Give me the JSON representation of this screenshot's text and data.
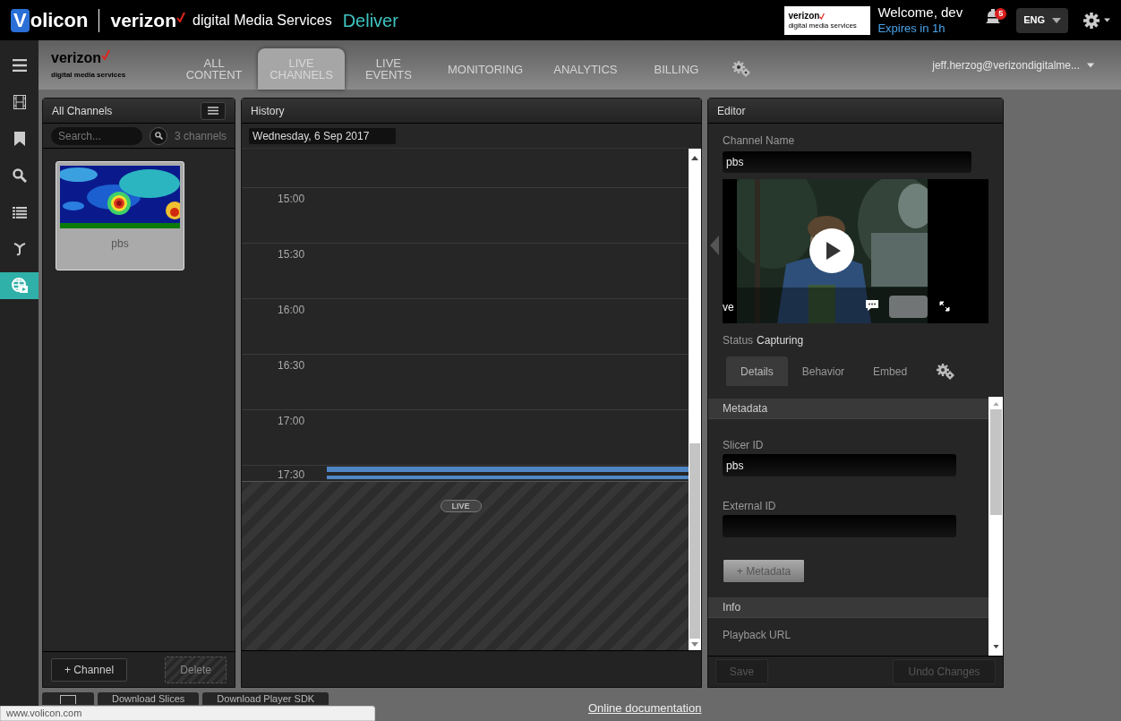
{
  "header": {
    "brand_mark": "V",
    "brand": "olicon",
    "partner": "verizon",
    "partner_sub": "digital Media Services",
    "product": "Deliver",
    "badge_logo": "verizon",
    "badge_sub": "digital media services",
    "welcome": "Welcome, dev",
    "expires": "Expires in 1h",
    "notifications": "5",
    "language": "ENG"
  },
  "sidebar": {
    "items": [
      {
        "kind": "film",
        "selected": false
      },
      {
        "kind": "bookmark",
        "selected": false
      },
      {
        "kind": "search",
        "selected": false
      },
      {
        "kind": "list",
        "selected": false
      },
      {
        "kind": "fork",
        "selected": false
      },
      {
        "kind": "globe",
        "selected": true
      }
    ]
  },
  "nav": {
    "logo": "verizon",
    "logo_sub": "digital media services",
    "tabs": [
      {
        "lines": [
          "ALL",
          "CONTENT"
        ],
        "selected": false
      },
      {
        "lines": [
          "LIVE",
          "CHANNELS"
        ],
        "selected": true
      },
      {
        "lines": [
          "LIVE",
          "EVENTS"
        ],
        "selected": false
      },
      {
        "lines": [
          "MONITORING"
        ],
        "selected": false
      },
      {
        "lines": [
          "ANALYTICS"
        ],
        "selected": false
      },
      {
        "lines": [
          "BILLING"
        ],
        "selected": false
      }
    ],
    "user": "jeff.herzog@verizondigitalme..."
  },
  "channels_panel": {
    "title": "All Channels",
    "search_placeholder": "Search...",
    "count": "3 channels",
    "cards": [
      {
        "name": "pbs"
      }
    ],
    "add_button": "+ Channel",
    "delete_button": {
      "label": "Delete",
      "disabled": true
    }
  },
  "history_panel": {
    "title": "History",
    "date": "Wednesday, 6 Sep 2017",
    "times": [
      "15:00",
      "15:30",
      "16:00",
      "16:30",
      "17:00",
      "17:30"
    ],
    "live_label": "LIVE"
  },
  "editor_panel": {
    "title": "Editor",
    "channel_name_label": "Channel Name",
    "channel_name": "pbs",
    "player_text": "ve",
    "status_label": "Status",
    "status": "Capturing",
    "tabs": [
      {
        "kind": "text",
        "label": "Details",
        "selected": true
      },
      {
        "kind": "text",
        "label": "Behavior",
        "selected": false
      },
      {
        "kind": "text",
        "label": "Embed",
        "selected": false
      },
      {
        "kind": "gear",
        "selected": false
      }
    ],
    "sections": [
      {
        "title": "Metadata",
        "fields": [
          {
            "label": "Slicer ID",
            "value": "pbs"
          },
          {
            "label": "External ID"
          }
        ],
        "button": "+ Metadata"
      },
      {
        "title": "Info",
        "fields": [
          {
            "label": "Playback URL"
          }
        ]
      }
    ],
    "save_button": {
      "label": "Save",
      "disabled": true
    },
    "undo_button": {
      "label": "Undo Changes",
      "disabled": true
    }
  },
  "footer": {
    "buttons": [
      "Download Slices",
      "Download Player SDK"
    ],
    "link": "Online documentation",
    "status_url": "www.volicon.com"
  }
}
